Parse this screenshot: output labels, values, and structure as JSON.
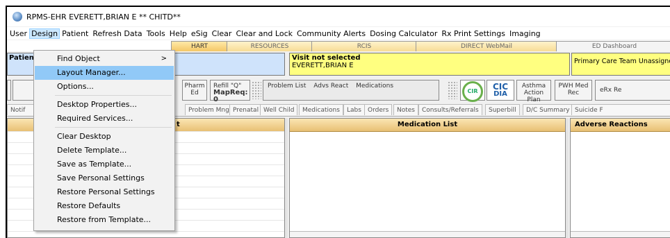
{
  "window": {
    "title": "RPMS-EHR EVERETT,BRIAN E   ** CHITD**"
  },
  "menubar": {
    "items": [
      "User",
      "Design",
      "Patient",
      "Refresh Data",
      "Tools",
      "Help",
      "eSig",
      "Clear",
      "Clear and Lock",
      "Community Alerts",
      "Dosing Calculator",
      "Rx Print Settings",
      "Imaging"
    ]
  },
  "top_tabs": [
    "HART",
    "RESOURCES",
    "RCIS",
    "DIRECT WebMail",
    "ED Dashboard"
  ],
  "patient_bar": {
    "patient_label": "Patien",
    "visit_title": "Visit not selected",
    "visit_patient": "EVERETT,BRIAN E",
    "care_team": "Primary Care Team Unassigned"
  },
  "toolbar": {
    "pharm_ed": "Pharm Ed",
    "refill": "Refill \"Q\"",
    "mapreq": "MapReq: 0",
    "problem_list": "Problem List",
    "advs_react": "Advs React",
    "medications": "Medications",
    "cir": "CIR",
    "cic_top": "CIC",
    "cic_bottom": "DIA",
    "asthma": "Asthma Action Plan",
    "pwh": "PWH Med Rec",
    "erx": "eRx Re"
  },
  "sub_tabs": [
    "Notif",
    "Problem Mngt",
    "Prenatal",
    "Well Child",
    "Medications",
    "Labs",
    "Orders",
    "Notes",
    "Consults/Referrals",
    "Superbill",
    "D/C Summary",
    "Suicide F"
  ],
  "panes": {
    "left_header": "t",
    "medication_header": "Medication List",
    "adverse_header": "Adverse Reactions"
  },
  "design_menu": {
    "items": [
      {
        "label": "Find Object",
        "submenu": true
      },
      {
        "label": "Layout Manager..."
      },
      {
        "label": "Options..."
      },
      {
        "label": "Desktop Properties..."
      },
      {
        "label": "Required Services..."
      },
      {
        "label": "Clear Desktop"
      },
      {
        "label": "Delete Template..."
      },
      {
        "label": "Save as Template..."
      },
      {
        "label": "Save Personal Settings"
      },
      {
        "label": "Restore Personal Settings"
      },
      {
        "label": "Restore Defaults"
      },
      {
        "label": "Restore from Template..."
      }
    ],
    "submenu_arrow": ">"
  }
}
